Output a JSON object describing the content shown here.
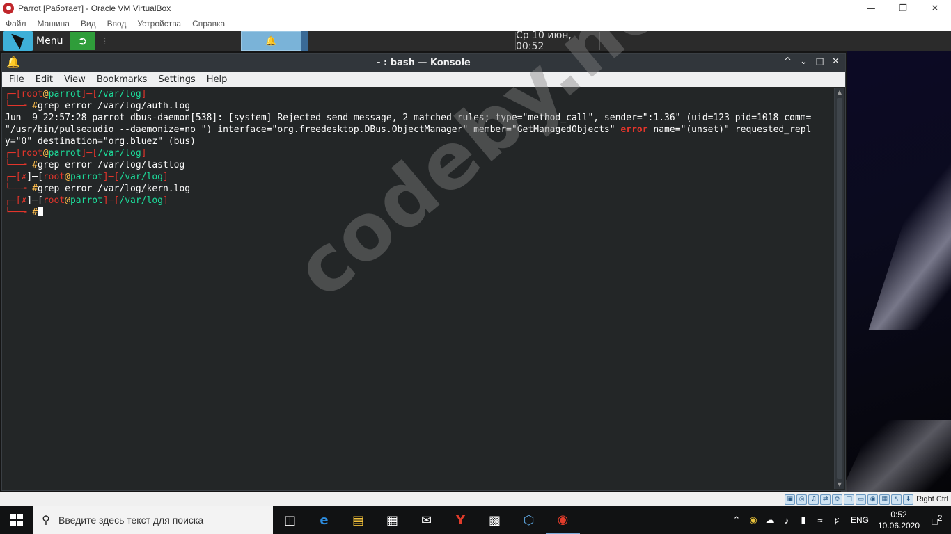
{
  "vbox": {
    "title": "Parrot [Работает] - Oracle VM VirtualBox",
    "menu": [
      "Файл",
      "Машина",
      "Вид",
      "Ввод",
      "Устройства",
      "Справка"
    ],
    "host_key": "Right Ctrl"
  },
  "panel": {
    "menu_label": "Menu",
    "clock": "Ср 10 июн, 00:52"
  },
  "konsole": {
    "title": "- : bash — Konsole",
    "menu": [
      "File",
      "Edit",
      "View",
      "Bookmarks",
      "Settings",
      "Help"
    ],
    "prompt": {
      "user": "root",
      "at": "@",
      "host": "parrot",
      "path": "/var/log",
      "symbol": "#",
      "fail_mark": "✗"
    },
    "commands": [
      "grep error /var/log/auth.log",
      "grep error /var/log/lastlog",
      "grep error /var/log/kern.log"
    ],
    "output": {
      "line1": "Jun  9 22:57:28 parrot dbus-daemon[538]: [system] Rejected send message, 2 matched rules; type=\"method_call\", sender=\":1.36\" (uid=123 pid=1018 comm=",
      "line2_pre": "\"/usr/bin/pulseaudio --daemonize=no \") interface=\"org.freedesktop.DBus.ObjectManager\" member=\"GetManagedObjects\" ",
      "line2_match": "error",
      "line2_post": " name=\"(unset)\" requested_repl",
      "line3": "y=\"0\" destination=\"org.bluez\" (bus)"
    }
  },
  "watermark": "codeby.net",
  "taskbar": {
    "search_placeholder": "Введите здесь текст для поиска",
    "lang": "ENG",
    "time": "0:52",
    "date": "10.06.2020",
    "notifications": "2"
  },
  "colors": {
    "prompt_red": "#e2352b",
    "prompt_green": "#1cdc9a",
    "path_blue": "#3daee9",
    "terminal_bg": "#232627"
  }
}
